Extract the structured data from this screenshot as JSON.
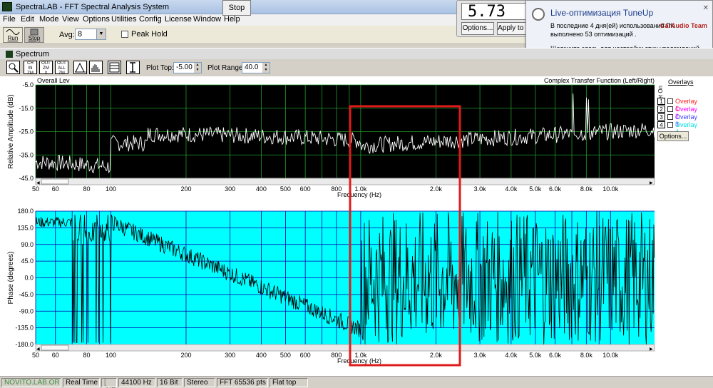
{
  "window": {
    "title": "SpectraLAB - FFT Spectral Analysis System"
  },
  "menu": [
    "File",
    "Edit",
    "Mode",
    "View",
    "Options",
    "Utilities",
    "Config",
    "License",
    "Window",
    "Help"
  ],
  "stop_popup": {
    "label": "Stop"
  },
  "toolbar": {
    "run_label": "Run",
    "stop_label": "Stop",
    "avg_label": "Avg:",
    "avg_value": "8",
    "peak_hold_label": "Peak Hold"
  },
  "spectrum_window": {
    "title": "Spectrum"
  },
  "plot_tools": {
    "plot_top_label": "Plot Top:",
    "plot_top_value": "-5.00",
    "plot_range_label": "Plot Range:",
    "plot_range_value": "40.0",
    "tools": [
      "zoom",
      "ch-in",
      "ch-out",
      "ch-out-a",
      "peak",
      "bars",
      "table",
      "cursor"
    ]
  },
  "top_plot": {
    "left_title": "Overall Lev",
    "right_title": "Complex Transfer Function (Left/Right)",
    "ylabel": "Relative Amplitude (dB)",
    "xlabel": "Frequency (Hz)",
    "yticks": [
      "-5.0",
      "-15.0",
      "-25.0",
      "-35.0",
      "-45.0"
    ],
    "xticks": [
      "50",
      "60",
      "80",
      "100",
      "200",
      "300",
      "400",
      "500",
      "600",
      "800",
      "1.0k",
      "2.0k",
      "3.0k",
      "4.0k",
      "5.0k",
      "6.0k",
      "8.0k",
      "10.0k"
    ],
    "colors": {
      "bg": "#000000",
      "grid": "#1f9a2a",
      "trace": "#ffffff"
    }
  },
  "bottom_plot": {
    "ylabel": "Phase (degrees)",
    "xlabel": "Frequency (Hz)",
    "yticks": [
      "180.0",
      "135.0",
      "90.0",
      "45.0",
      "0.0",
      "-45.0",
      "-90.0",
      "-135.0",
      "-180.0"
    ],
    "xticks": [
      "50",
      "60",
      "80",
      "100",
      "200",
      "300",
      "400",
      "500",
      "600",
      "800",
      "1.0k",
      "2.0k",
      "3.0k",
      "4.0k",
      "5.0k",
      "6.0k",
      "8.0k",
      "10.0k"
    ],
    "colors": {
      "bg": "#00ffff",
      "grid": "#0000aa",
      "trace": "#000000"
    }
  },
  "highlight_box": {
    "color": "#e01b1b"
  },
  "overlays": {
    "title": "Overlays",
    "set_on_label": "Set On",
    "items": [
      {
        "num": "1",
        "name": "Overlay 1",
        "color": "#ff2020"
      },
      {
        "num": "2",
        "name": "Overlay 2",
        "color": "#ff00ff"
      },
      {
        "num": "3",
        "name": "Overlay 3",
        "color": "#4040ff"
      },
      {
        "num": "4",
        "name": "Overlay 4",
        "color": "#00e0e0"
      }
    ],
    "options_label": "Options..."
  },
  "meter": {
    "value": "5.73",
    "options_label": "Options...",
    "apply_label": "Apply to I"
  },
  "notification": {
    "title": "Live-оптимизация TuneUp",
    "body": "В последние 4 дня(ей) использования ПК выполнено 53 оптимизаций .",
    "footer": "Щелкните здесь для настройки этих уведомлений.",
    "watermark": "CarAudio Team"
  },
  "status": {
    "cells": [
      "NOVITO.LAB.OR",
      "Real Time",
      "[ .NE",
      "44100 Hz",
      "16 Bit",
      "Stereo",
      "FFT 65536 pts",
      "Flat top"
    ]
  }
}
